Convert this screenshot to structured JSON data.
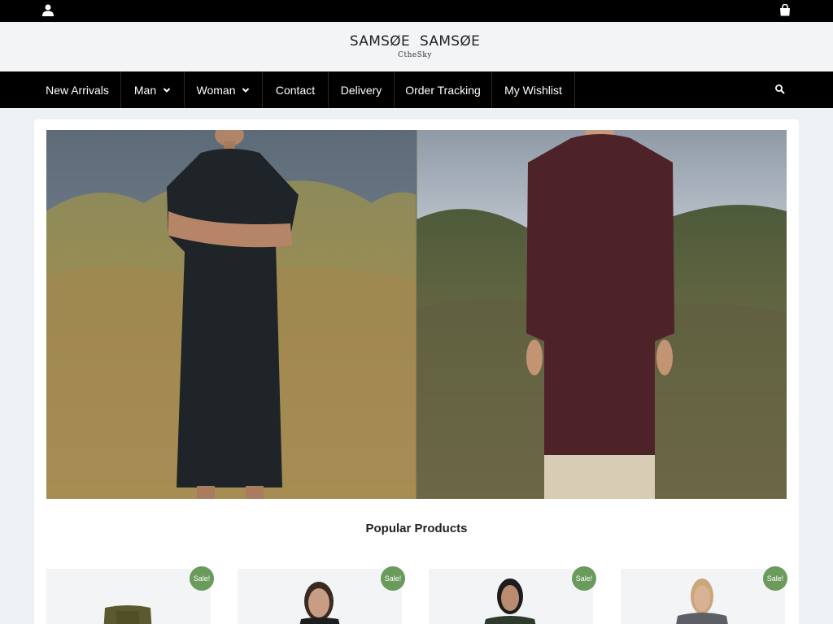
{
  "topbar": {
    "user_icon": "user-icon",
    "cart_icon": "shopping-bag-icon"
  },
  "brand": {
    "name_left": "SAMSØE",
    "name_right": "SAMSØE",
    "tagline": "CtheSky"
  },
  "nav": {
    "items": [
      {
        "label": "New Arrivals"
      },
      {
        "label": "Man"
      },
      {
        "label": "Woman"
      },
      {
        "label": "Contact"
      },
      {
        "label": "Delivery"
      },
      {
        "label": "Order Tracking"
      },
      {
        "label": "My Wishlist"
      }
    ],
    "search_icon": "search-icon"
  },
  "section": {
    "title": "Popular Products"
  },
  "products": [
    {
      "badge": "Sale!"
    },
    {
      "badge": "Sale!"
    },
    {
      "badge": "Sale!"
    },
    {
      "badge": "Sale!"
    }
  ],
  "colors": {
    "accent_sale": "#6a9a5c",
    "bar": "#000000"
  }
}
